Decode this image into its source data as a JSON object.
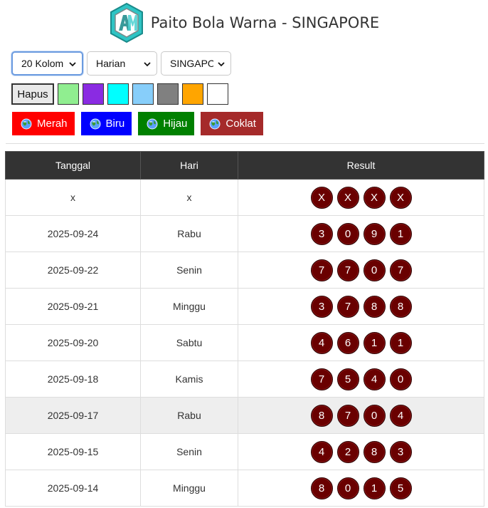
{
  "header": {
    "title": "Paito Bola Warna - SINGAPORE",
    "logo_icon": "am-logo-icon"
  },
  "controls": {
    "columns": {
      "selected": "20 Kolom"
    },
    "period": {
      "selected": "Harian"
    },
    "market": {
      "selected": "SINGAPO"
    }
  },
  "palette": {
    "clear_label": "Hapus",
    "swatches": [
      "#90ee90",
      "#8a2be2",
      "#00ffff",
      "#87cefa",
      "#808080",
      "#ffa500",
      "#ffffff"
    ]
  },
  "color_buttons": [
    {
      "label": "Merah",
      "color": "#ff0000"
    },
    {
      "label": "Biru",
      "color": "#0000ff"
    },
    {
      "label": "Hijau",
      "color": "#008000"
    },
    {
      "label": "Coklat",
      "color": "#a52a2a"
    }
  ],
  "table": {
    "headers": [
      "Tanggal",
      "Hari",
      "Result"
    ],
    "rows": [
      {
        "date": "x",
        "day": "x",
        "result": [
          "X",
          "X",
          "X",
          "X"
        ]
      },
      {
        "date": "2025-09-24",
        "day": "Rabu",
        "result": [
          "3",
          "0",
          "9",
          "1"
        ]
      },
      {
        "date": "2025-09-22",
        "day": "Senin",
        "result": [
          "7",
          "7",
          "0",
          "7"
        ]
      },
      {
        "date": "2025-09-21",
        "day": "Minggu",
        "result": [
          "3",
          "7",
          "8",
          "8"
        ]
      },
      {
        "date": "2025-09-20",
        "day": "Sabtu",
        "result": [
          "4",
          "6",
          "1",
          "1"
        ]
      },
      {
        "date": "2025-09-18",
        "day": "Kamis",
        "result": [
          "7",
          "5",
          "4",
          "0"
        ]
      },
      {
        "date": "2025-09-17",
        "day": "Rabu",
        "result": [
          "8",
          "7",
          "0",
          "4"
        ]
      },
      {
        "date": "2025-09-15",
        "day": "Senin",
        "result": [
          "4",
          "2",
          "8",
          "3"
        ]
      },
      {
        "date": "2025-09-14",
        "day": "Minggu",
        "result": [
          "8",
          "0",
          "1",
          "5"
        ]
      }
    ]
  }
}
